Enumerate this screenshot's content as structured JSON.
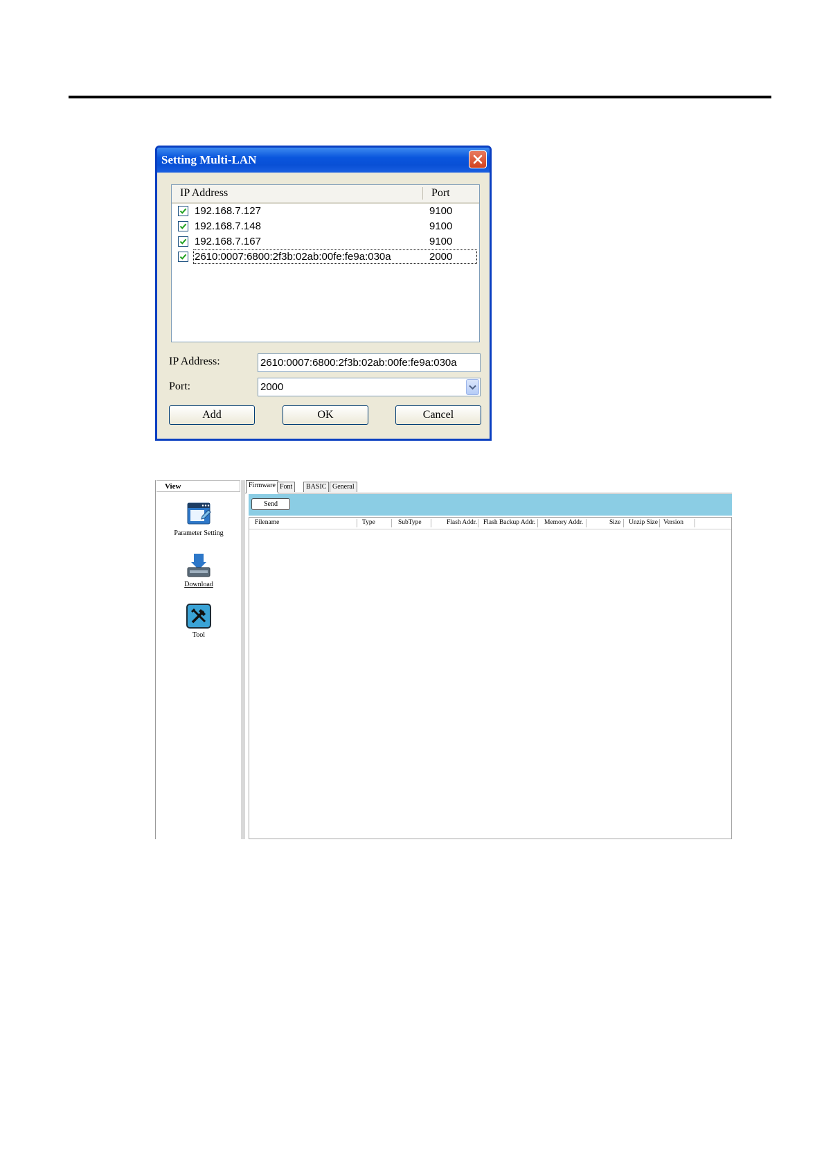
{
  "dialog": {
    "title": "Setting Multi-LAN",
    "list": {
      "columns": {
        "ip": "IP Address",
        "port": "Port"
      },
      "rows": [
        {
          "ip": "192.168.7.127",
          "port": "9100",
          "checked": true
        },
        {
          "ip": "192.168.7.148",
          "port": "9100",
          "checked": true
        },
        {
          "ip": "192.168.7.167",
          "port": "9100",
          "checked": true
        },
        {
          "ip": "2610:0007:6800:2f3b:02ab:00fe:fe9a:030a",
          "port": "2000",
          "checked": true
        }
      ]
    },
    "ip_label": "IP Address:",
    "ip_value": "2610:0007:6800:2f3b:02ab:00fe:fe9a:030a",
    "port_label": "Port:",
    "port_value": "2000",
    "buttons": {
      "add": "Add",
      "ok": "OK",
      "cancel": "Cancel"
    },
    "colors": {
      "titlebar": "#0a56dd",
      "body": "#ece9d8",
      "close": "#d2421f"
    }
  },
  "app": {
    "view_title": "View",
    "nav": [
      {
        "label": "Parameter Setting",
        "icon": "parameter-setting-icon"
      },
      {
        "label": "Download",
        "icon": "download-icon"
      },
      {
        "label": "Tool",
        "icon": "tool-icon"
      }
    ],
    "tabs": [
      "Firmware",
      "Font",
      "BASIC",
      "General"
    ],
    "active_tab": "Firmware",
    "send_label": "Send",
    "columns": [
      "Filename",
      "Type",
      "SubType",
      "Flash Addr.",
      "Flash Backup Addr.",
      "Memory Addr.",
      "Size",
      "Unzip Size",
      "Version"
    ],
    "colors": {
      "toolbar": "#8bcde4"
    }
  }
}
